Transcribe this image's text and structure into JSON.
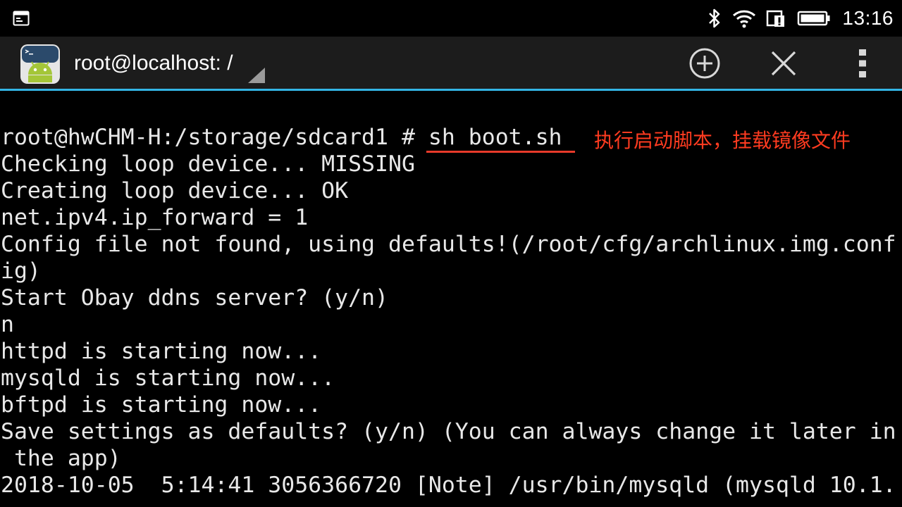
{
  "status_bar": {
    "time": "13:16",
    "icons": [
      "terminal-notification-icon",
      "bluetooth-icon",
      "wifi-icon",
      "data-alert-icon",
      "battery-icon"
    ]
  },
  "action_bar": {
    "title": "root@localhost: /",
    "accent_color": "#33b5e5",
    "actions": [
      "add-session",
      "close-session",
      "overflow-menu"
    ]
  },
  "terminal": {
    "text_color": "#e8e8e8",
    "background": "#000000",
    "lines": [
      "root@hwCHM-H:/storage/sdcard1 # sh boot.sh",
      "Checking loop device... MISSING",
      "Creating loop device... OK",
      "net.ipv4.ip_forward = 1",
      "Config file not found, using defaults!(/root/cfg/archlinux.img.conf",
      "ig)",
      "Start Obay ddns server? (y/n)",
      "n",
      "httpd is starting now...",
      "mysqld is starting now...",
      "bftpd is starting now...",
      "Save settings as defaults? (y/n) (You can always change it later in",
      " the app)",
      "2018-10-05  5:14:41 3056366720 [Note] /usr/bin/mysqld (mysqld 10.1."
    ]
  },
  "annotation": {
    "text": "执行启动脚本，挂载镜像文件",
    "color": "#ff3b20"
  }
}
